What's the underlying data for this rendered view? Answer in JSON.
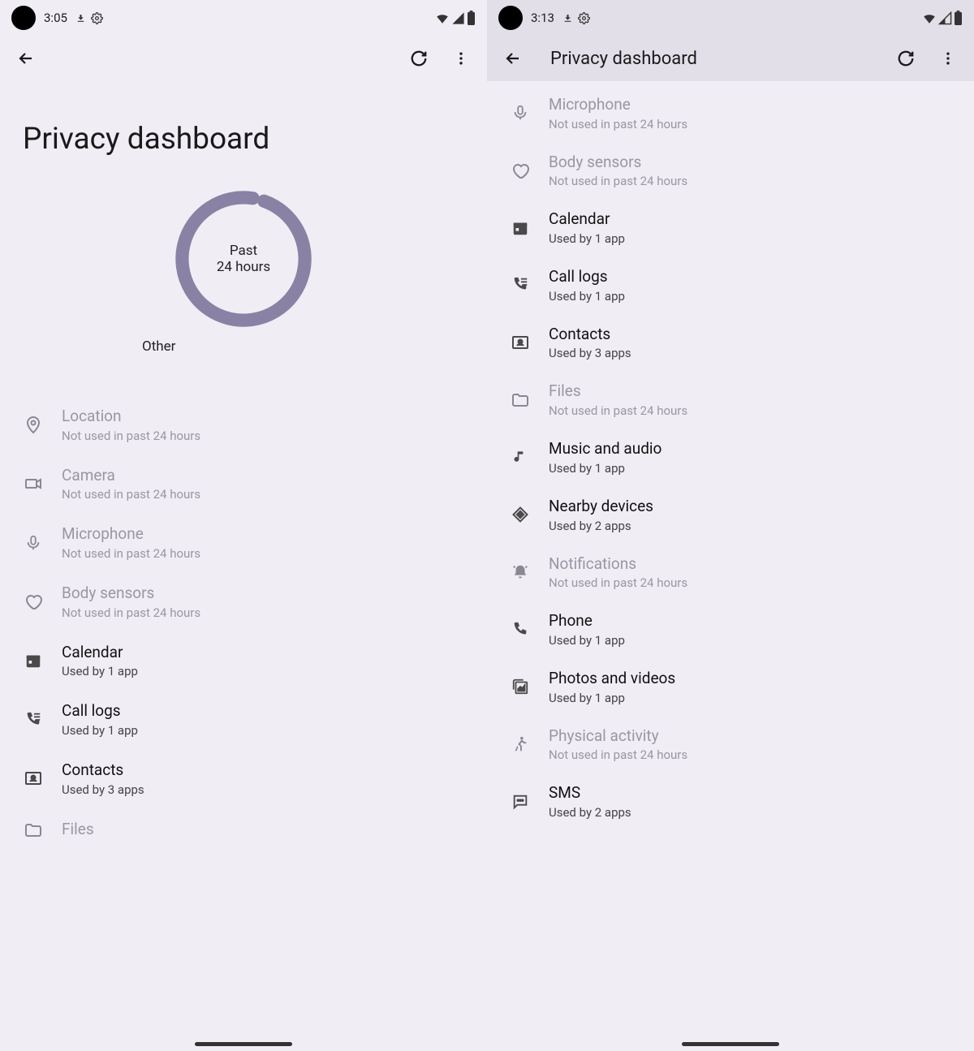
{
  "left": {
    "status": {
      "time": "3:05"
    },
    "title": "Privacy dashboard",
    "chart": {
      "line1": "Past",
      "line2": "24 hours",
      "label": "Other"
    },
    "rows": [
      {
        "icon": "location",
        "title": "Location",
        "sub": "Not used in past 24 hours",
        "disabled": true
      },
      {
        "icon": "camera",
        "title": "Camera",
        "sub": "Not used in past 24 hours",
        "disabled": true
      },
      {
        "icon": "mic",
        "title": "Microphone",
        "sub": "Not used in past 24 hours",
        "disabled": true
      },
      {
        "icon": "heart",
        "title": "Body sensors",
        "sub": "Not used in past 24 hours",
        "disabled": true
      },
      {
        "icon": "calendar",
        "title": "Calendar",
        "sub": "Used by 1 app",
        "disabled": false
      },
      {
        "icon": "calllog",
        "title": "Call logs",
        "sub": "Used by 1 app",
        "disabled": false
      },
      {
        "icon": "contacts",
        "title": "Contacts",
        "sub": "Used by 3 apps",
        "disabled": false
      },
      {
        "icon": "folder",
        "title": "Files",
        "sub": "",
        "disabled": true
      }
    ]
  },
  "right": {
    "status": {
      "time": "3:13"
    },
    "title": "Privacy dashboard",
    "rows": [
      {
        "icon": "mic",
        "title": "Microphone",
        "sub": "Not used in past 24 hours",
        "disabled": true
      },
      {
        "icon": "heart",
        "title": "Body sensors",
        "sub": "Not used in past 24 hours",
        "disabled": true
      },
      {
        "icon": "calendar",
        "title": "Calendar",
        "sub": "Used by 1 app",
        "disabled": false
      },
      {
        "icon": "calllog",
        "title": "Call logs",
        "sub": "Used by 1 app",
        "disabled": false
      },
      {
        "icon": "contacts",
        "title": "Contacts",
        "sub": "Used by 3 apps",
        "disabled": false
      },
      {
        "icon": "folder",
        "title": "Files",
        "sub": "Not used in past 24 hours",
        "disabled": true
      },
      {
        "icon": "music",
        "title": "Music and audio",
        "sub": "Used by 1 app",
        "disabled": false
      },
      {
        "icon": "nearby",
        "title": "Nearby devices",
        "sub": "Used by 2 apps",
        "disabled": false
      },
      {
        "icon": "bell",
        "title": "Notifications",
        "sub": "Not used in past 24 hours",
        "disabled": true
      },
      {
        "icon": "phone",
        "title": "Phone",
        "sub": "Used by 1 app",
        "disabled": false
      },
      {
        "icon": "photos",
        "title": "Photos and videos",
        "sub": "Used by 1 app",
        "disabled": false
      },
      {
        "icon": "activity",
        "title": "Physical activity",
        "sub": "Not used in past 24 hours",
        "disabled": true
      },
      {
        "icon": "sms",
        "title": "SMS",
        "sub": "Used by 2 apps",
        "disabled": false
      }
    ]
  },
  "chart_data": {
    "type": "pie",
    "title": "Past 24 hours",
    "categories": [
      "Other"
    ],
    "values": [
      100
    ]
  }
}
